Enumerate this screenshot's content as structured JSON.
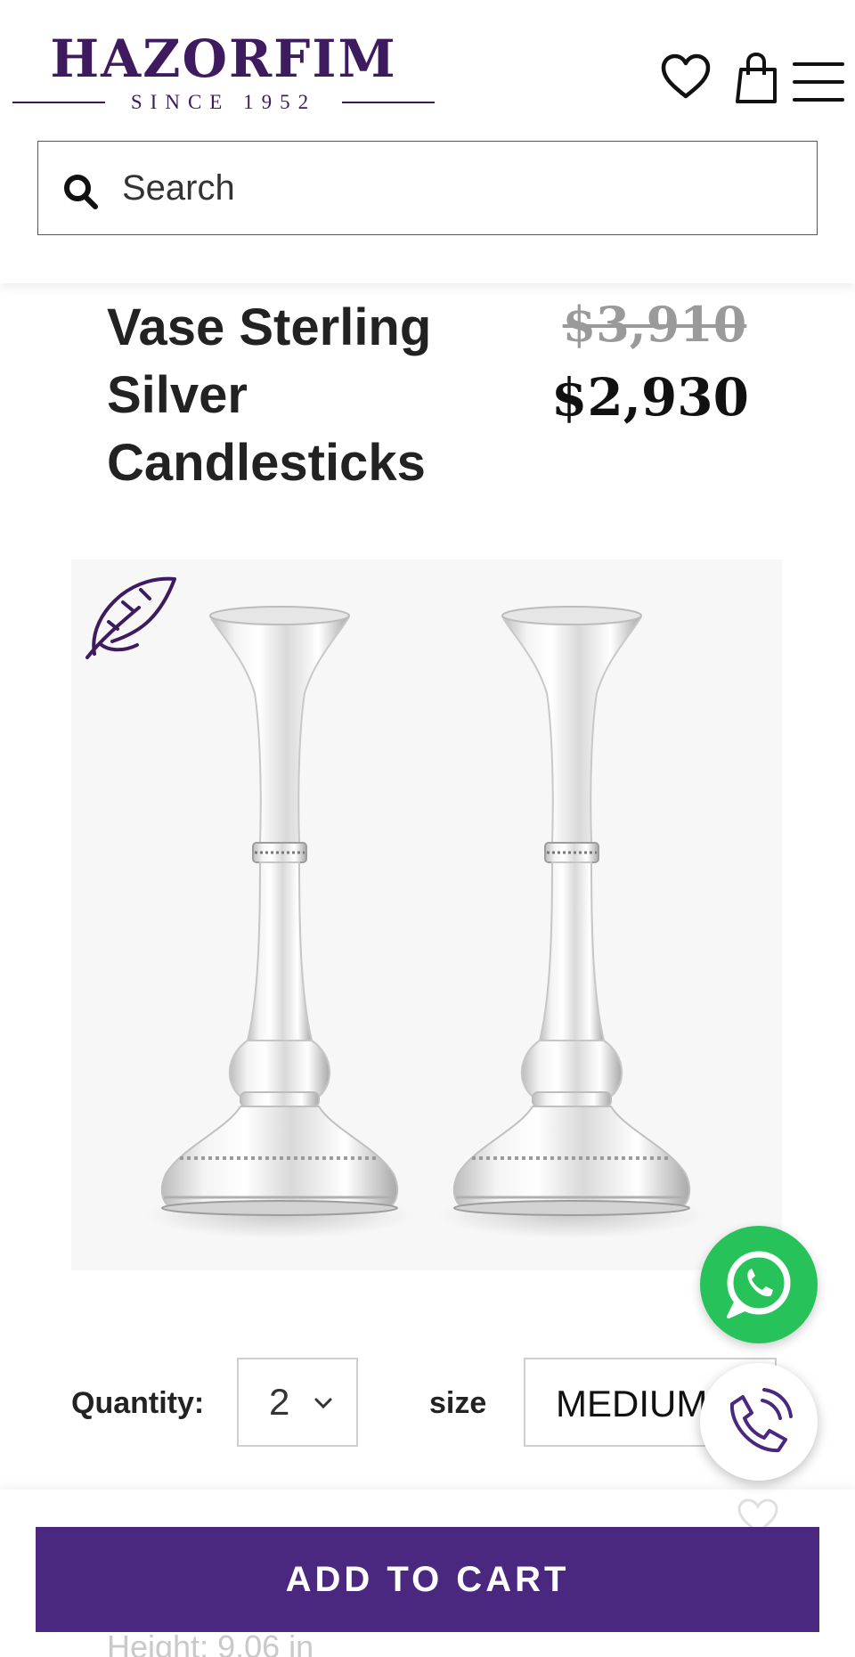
{
  "header": {
    "brand": "HAZORFIM",
    "tagline": "SINCE 1952",
    "icons": [
      "heart-icon",
      "shopping-bag-icon",
      "hamburger-menu-icon"
    ]
  },
  "search": {
    "placeholder": "Search",
    "icon": "search-icon"
  },
  "product": {
    "title": "Vase Sterling Silver Candlesticks",
    "original_price": "$3,910",
    "sale_price": "$2,930",
    "badge_icon": "feather-icon"
  },
  "options": {
    "quantity_label": "Quantity:",
    "quantity_value": "2",
    "size_label": "size",
    "size_value": "MEDIUM"
  },
  "floating": {
    "whatsapp_icon": "whatsapp-icon",
    "phone_icon": "phone-icon"
  },
  "bottom_bar": {
    "add_to_cart_label": "ADD TO CART",
    "height_label": "Height:",
    "height_value": "9.06 in"
  },
  "colors": {
    "brand": "#3d1b5e",
    "button": "#4b2880",
    "whatsapp": "#27c35a",
    "price_old": "#9a9a9a"
  }
}
